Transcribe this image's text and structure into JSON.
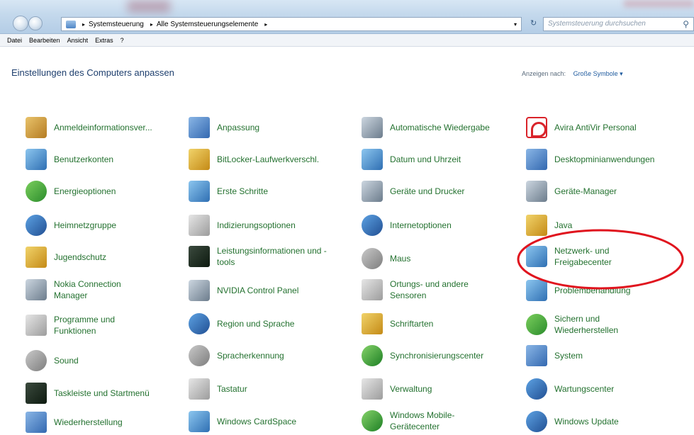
{
  "address_bar": {
    "crumbs": [
      "Systemsteuerung",
      "Alle Systemsteuerungselemente"
    ],
    "search_placeholder": "Systemsteuerung durchsuchen"
  },
  "menu": [
    "Datei",
    "Bearbeiten",
    "Ansicht",
    "Extras",
    "?"
  ],
  "header": {
    "title": "Einstellungen des Computers anpassen",
    "view_by_label": "Anzeigen nach:",
    "view_by_value": "Große Symbole"
  },
  "items": [
    "Anmeldeinformationsver...",
    "Anpassung",
    "Automatische Wiedergabe",
    "Avira AntiVir Personal",
    "Benutzerkonten",
    "BitLocker-Laufwerkverschl.",
    "Datum und Uhrzeit",
    "Desktopminianwendungen",
    "Energieoptionen",
    "Erste Schritte",
    "Geräte und Drucker",
    "Geräte-Manager",
    "Heimnetzgruppe",
    "Indizierungsoptionen",
    "Internetoptionen",
    "Java",
    "Jugendschutz",
    "Leistungsinformationen und -tools",
    "Maus",
    "Netzwerk- und Freigabecenter",
    "Nokia Connection Manager",
    "NVIDIA Control Panel",
    "Ortungs- und andere Sensoren",
    "Problembehandlung",
    "Programme und Funktionen",
    "Region und Sprache",
    "Schriftarten",
    "Sichern und Wiederherstellen",
    "Sound",
    "Spracherkennung",
    "Synchronisierungscenter",
    "System",
    "Taskleiste und Startmenü",
    "Tastatur",
    "Verwaltung",
    "Wartungscenter",
    "Wiederherstellung",
    "Windows CardSpace",
    "Windows Mobile-Gerätecenter",
    "Windows Update"
  ]
}
